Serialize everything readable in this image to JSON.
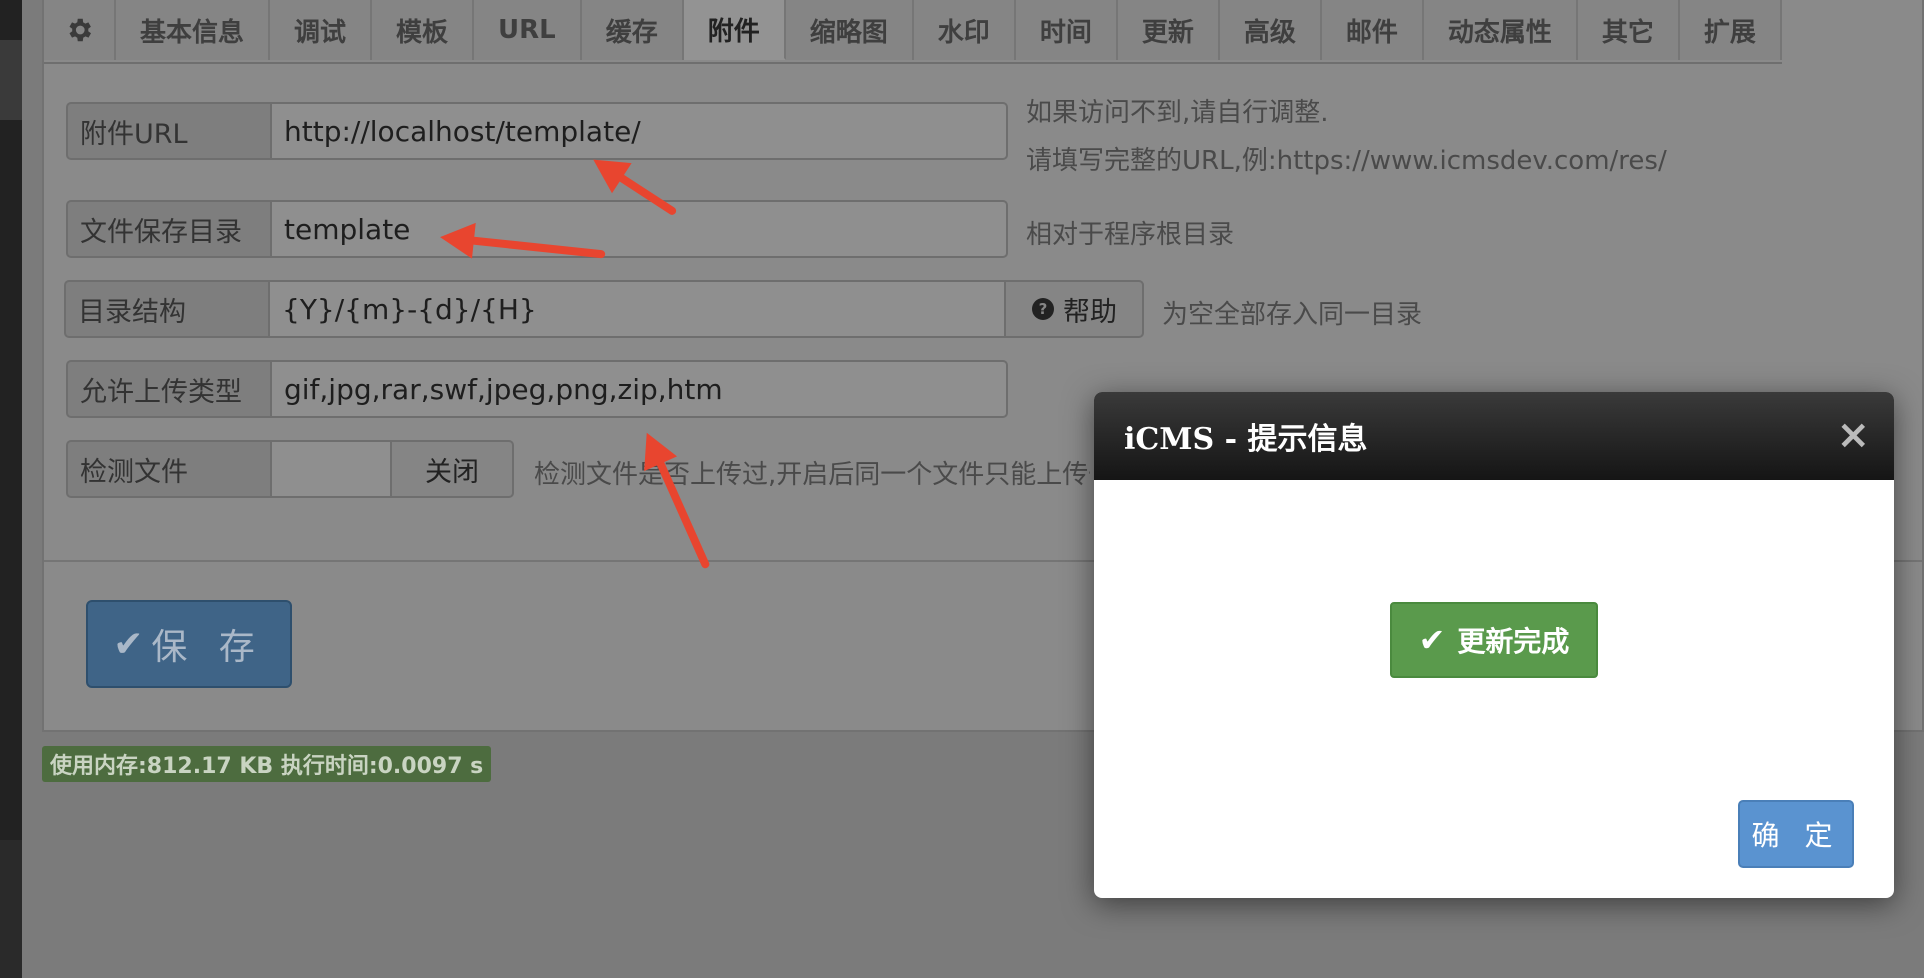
{
  "tabs": [
    "基本信息",
    "调试",
    "模板",
    "URL",
    "缓存",
    "附件",
    "缩略图",
    "水印",
    "时间",
    "更新",
    "高级",
    "邮件",
    "动态属性",
    "其它",
    "扩展"
  ],
  "active_tab": "附件",
  "form": {
    "attach_url": {
      "label": "附件URL",
      "value": "http://localhost/template/",
      "help_line1": "如果访问不到,请自行调整.",
      "help_line2": "请填写完整的URL,例:https://www.icmsdev.com/res/"
    },
    "save_dir": {
      "label": "文件保存目录",
      "value": "template",
      "help": "相对于程序根目录"
    },
    "dir_structure": {
      "label": "目录结构",
      "value": "{Y}/{m}-{d}/{H}",
      "help_button": "帮助",
      "help": "为空全部存入同一目录"
    },
    "allowed_types": {
      "label": "允许上传类型",
      "value": "gif,jpg,rar,swf,jpeg,png,zip,htm"
    },
    "check_file": {
      "label": "检测文件",
      "toggle": "关闭",
      "help": "检测文件是否上传过,开启后同一个文件只能上传一次"
    }
  },
  "save_button": "保 存",
  "status_bar": "使用内存:812.17 KB 执行时间:0.0097 s",
  "dialog": {
    "title": "iCMS - 提示信息",
    "message": "更新完成",
    "ok_button": "确 定"
  },
  "colors": {
    "arrow": "#e8452f",
    "success": "#5a9a4c",
    "primary": "#5a93d0"
  }
}
